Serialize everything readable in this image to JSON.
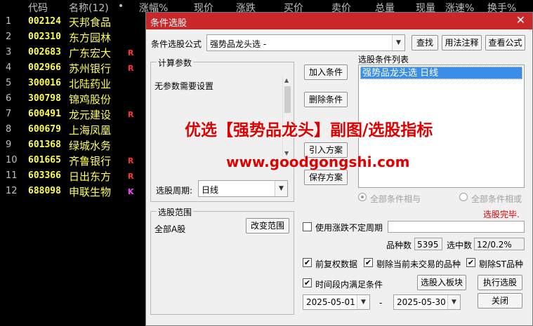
{
  "list_header": {
    "code": "代码",
    "name": "名称(12)",
    "dot": "•",
    "change_pct": "涨幅%",
    "price": "现价",
    "change": "涨跌",
    "bid": "买价",
    "ask": "卖价",
    "volume": "总量",
    "cur_volume": "现量",
    "speed": "涨速%",
    "turnover": "换手%"
  },
  "stocks": [
    {
      "num": "1",
      "code": "002124",
      "name": "天邦食品",
      "flag": ""
    },
    {
      "num": "2",
      "code": "002310",
      "name": "东方园林",
      "flag": ""
    },
    {
      "num": "3",
      "code": "002683",
      "name": "广东宏大",
      "flag": "R"
    },
    {
      "num": "4",
      "code": "002966",
      "name": "苏州银行",
      "flag": "R"
    },
    {
      "num": "5",
      "code": "300016",
      "name": "北陆药业",
      "flag": ""
    },
    {
      "num": "6",
      "code": "300798",
      "name": "锦鸡股份",
      "flag": ""
    },
    {
      "num": "7",
      "code": "600491",
      "name": "龙元建设",
      "flag": "R"
    },
    {
      "num": "8",
      "code": "600679",
      "name": "上海凤凰",
      "flag": ""
    },
    {
      "num": "9",
      "code": "601368",
      "name": "绿城水务",
      "flag": ""
    },
    {
      "num": "10",
      "code": "601665",
      "name": "齐鲁银行",
      "flag": "R"
    },
    {
      "num": "11",
      "code": "603366",
      "name": "日出东方",
      "flag": "R"
    },
    {
      "num": "12",
      "code": "688098",
      "name": "申联生物",
      "flag": "K"
    }
  ],
  "dialog": {
    "title": "条件选股",
    "close": "✕",
    "formula_label": "条件选股公式",
    "formula_value": "强势品龙头选 -",
    "find_button": "查找",
    "usage_button": "用法注释",
    "view_button": "查看公式",
    "params_group": "计算参数",
    "params_text": "无参数需要设置",
    "add_condition": "加入条件",
    "delete_condition": "删除条件",
    "import_plan": "引入方案",
    "save_plan": "保存方案",
    "conditions_list_label": "选股条件列表",
    "conditions": [
      "强势品龙头选  日线"
    ],
    "all_and": "全部条件相与",
    "all_or": "全部条件相或",
    "status": "选股完毕.",
    "period_label": "选股周期:",
    "period_value": "日线",
    "scope_group": "选股范围",
    "scope_value": "全部A股",
    "change_scope": "改变范围",
    "use_uncertain_period": "使用涨跌不定周期",
    "count_label": "品种数",
    "count_value": "5395",
    "selected_label": "选中数",
    "selected_value": "12/0.2%",
    "pre_adjust": "前复权数据",
    "remove_untraded": "剔除当前未交易的品种",
    "remove_st": "剔除ST品种",
    "time_range": "时间段内满足条件",
    "select_to_board": "选股入板块",
    "run_select": "执行选股",
    "date_from": "2025-05-01",
    "date_sep": "-",
    "date_to": "2025-05-30",
    "close_button": "关闭"
  },
  "overlay": {
    "line1": "优选【强势品龙头】副图/选股指标",
    "line2": "www.goodgongshi.com"
  },
  "colors": {
    "title_bar": "#c8282a",
    "stock_text": "#ffff54",
    "flag_r": "#ff3030",
    "flag_k": "#ff40ff",
    "status_red": "#e00000",
    "list_selection": "#3a8ee6"
  }
}
